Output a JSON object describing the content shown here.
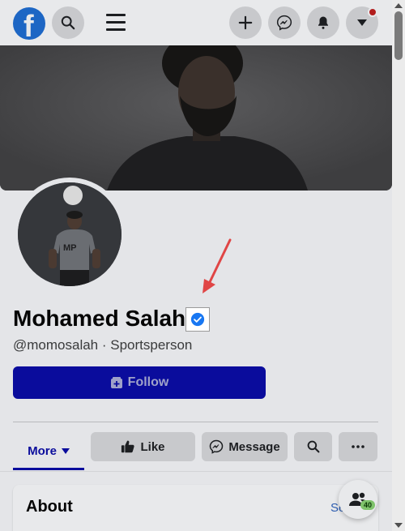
{
  "topbar": {
    "logo_letter": "f",
    "icons": [
      "search-icon",
      "menu-icon",
      "plus-icon",
      "messenger-icon",
      "bell-icon",
      "caret-down-icon"
    ]
  },
  "profile": {
    "name": "Mohamed Salah",
    "verified": true,
    "subtitle": "@momosalah · Sportsperson"
  },
  "buttons": {
    "follow_label": "Follow",
    "more_label": "More",
    "like_label": "Like",
    "message_label": "Message"
  },
  "about": {
    "title": "About",
    "see_all_label": "Se"
  },
  "friends_fab": {
    "count": "40"
  },
  "colors": {
    "brand": "#1877f2",
    "follow_bg": "#0a0c9c",
    "annotation_arrow": "#e04545"
  }
}
